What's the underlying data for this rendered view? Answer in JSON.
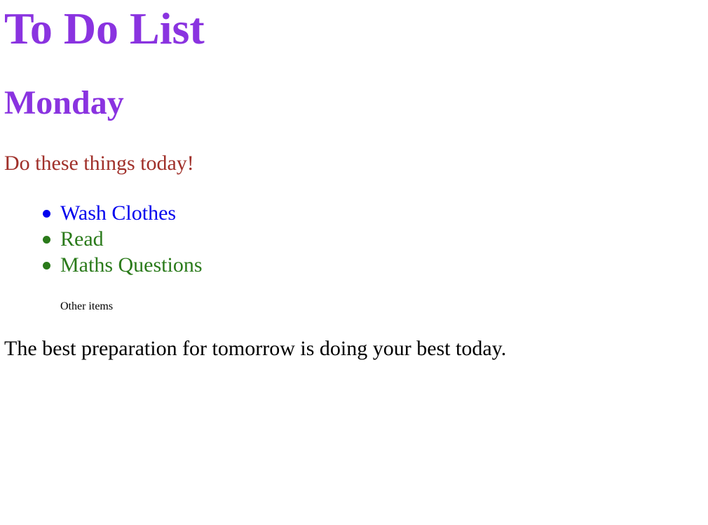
{
  "header": {
    "title": "To Do List",
    "day": "Monday",
    "intro": "Do these things today!"
  },
  "tasks": [
    {
      "label": "Wash Clothes",
      "color": "#0000ee"
    },
    {
      "label": "Read",
      "color": "#2a7a1a"
    },
    {
      "label": "Maths Questions",
      "color": "#2a7a1a"
    }
  ],
  "other_items": "Other items",
  "quote": "The best preparation for tomorrow is doing your best today.",
  "colors": {
    "title": "#8a33e0",
    "intro": "#a0302a",
    "text": "#000000"
  }
}
